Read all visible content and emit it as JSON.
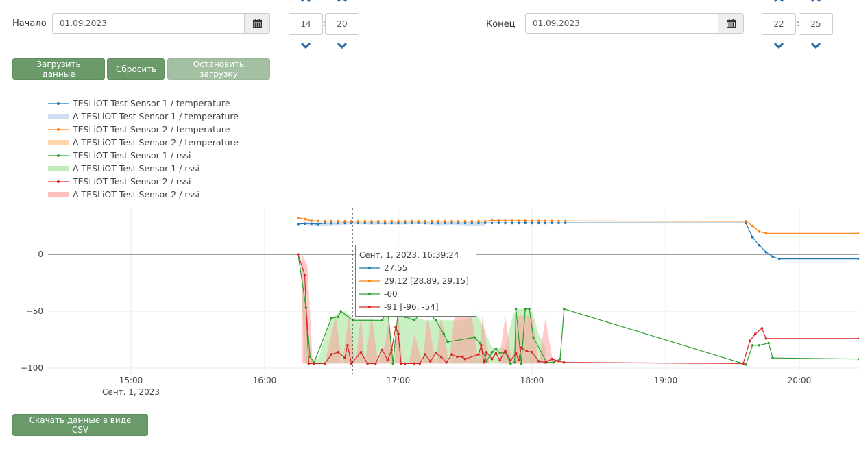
{
  "controls": {
    "start_label": "Начало",
    "start_date": "01.09.2023",
    "start_hour": "14",
    "start_minute": "20",
    "end_label": "Конец",
    "end_date": "01.09.2023",
    "end_hour": "22",
    "end_minute": "25",
    "time_separator": ":"
  },
  "buttons": {
    "load": "Загрузить данные",
    "reset": "Сбросить",
    "stop": "Остановить загрузку",
    "download_csv": "Скачать данные в виде CSV"
  },
  "legend": [
    {
      "label": "TESLiOT Test Sensor 1 / temperature",
      "kind": "line",
      "color": "#1f77b4"
    },
    {
      "label": "Δ TESLiOT Test Sensor 1 / temperature",
      "kind": "band",
      "color": "#aec7e8"
    },
    {
      "label": "TESLiOT Test Sensor 2 / temperature",
      "kind": "line",
      "color": "#ff7f0e"
    },
    {
      "label": "Δ TESLiOT Test Sensor 2 / temperature",
      "kind": "band",
      "color": "#ffbb78"
    },
    {
      "label": "TESLiOT Test Sensor 1 / rssi",
      "kind": "line",
      "color": "#2ca02c"
    },
    {
      "label": "Δ TESLiOT Test Sensor 1 / rssi",
      "kind": "band",
      "color": "#98df8a"
    },
    {
      "label": "TESLiOT Test Sensor 2 / rssi",
      "kind": "line",
      "color": "#d62728"
    },
    {
      "label": "Δ TESLiOT Test Sensor 2 / rssi",
      "kind": "band",
      "color": "#ff9896"
    }
  ],
  "tooltip": {
    "title": "Сент. 1, 2023, 16:39:24",
    "rows": [
      {
        "text": "27.55",
        "color": "#1f77b4"
      },
      {
        "text": "29.12 [28.89, 29.15]",
        "color": "#ff7f0e"
      },
      {
        "text": "-60",
        "color": "#2ca02c"
      },
      {
        "text": "-91 [-96, -54]",
        "color": "#d62728"
      }
    ]
  },
  "chart_data": {
    "type": "line",
    "x_unit": "hours",
    "xlim": [
      14.45,
      20.45
    ],
    "ylim": [
      -105,
      40
    ],
    "x_ticks": [
      {
        "value": 15,
        "label": "15:00",
        "sublabel": "Сент. 1, 2023"
      },
      {
        "value": 16,
        "label": "16:00"
      },
      {
        "value": 17,
        "label": "17:00"
      },
      {
        "value": 18,
        "label": "18:00"
      },
      {
        "value": 19,
        "label": "19:00"
      },
      {
        "value": 20,
        "label": "20:00"
      }
    ],
    "y_ticks": [
      {
        "value": 0,
        "label": "0"
      },
      {
        "value": -50,
        "label": "−50"
      },
      {
        "value": -100,
        "label": "−100"
      }
    ],
    "crosshair_x": 16.657,
    "grid": true,
    "series": [
      {
        "name": "TESLiOT Test Sensor 1 / temperature",
        "color": "#1f77b4",
        "markers": true,
        "x": [
          16.25,
          16.3,
          16.35,
          16.4,
          16.45,
          16.5,
          16.55,
          16.6,
          16.65,
          16.7,
          16.75,
          16.8,
          16.85,
          16.9,
          16.95,
          17.0,
          17.05,
          17.1,
          17.15,
          17.2,
          17.25,
          17.3,
          17.35,
          17.4,
          17.45,
          17.5,
          17.55,
          17.6,
          17.65,
          17.7,
          17.75,
          17.8,
          17.85,
          17.9,
          17.95,
          18.0,
          18.05,
          18.1,
          18.15,
          18.2,
          18.25,
          19.6,
          19.65,
          19.7,
          19.75,
          19.8,
          19.85,
          20.45
        ],
        "y": [
          26.5,
          27,
          27,
          26.5,
          27.5,
          27.3,
          27.5,
          27.5,
          27.55,
          27.5,
          27.4,
          27.5,
          27.5,
          27.3,
          27.5,
          27.4,
          27.5,
          27.5,
          27.5,
          27.5,
          27.4,
          27.5,
          27.5,
          27.5,
          27.4,
          27.5,
          27.5,
          27.5,
          27.6,
          27.5,
          27.6,
          27.5,
          27.5,
          27.5,
          27.6,
          27.5,
          27.5,
          27.5,
          27.6,
          27.5,
          27.6,
          27.5,
          15,
          8,
          2,
          -2,
          -4,
          -4
        ]
      },
      {
        "name": "TESLiOT Test Sensor 2 / temperature",
        "color": "#ff7f0e",
        "markers": true,
        "x": [
          16.25,
          16.3,
          16.35,
          16.4,
          16.45,
          16.5,
          16.55,
          16.6,
          16.65,
          16.7,
          16.75,
          16.8,
          16.85,
          16.9,
          16.95,
          17.0,
          17.05,
          17.1,
          17.15,
          17.2,
          17.25,
          17.3,
          17.35,
          17.4,
          17.45,
          17.5,
          17.55,
          17.6,
          17.65,
          17.7,
          17.75,
          17.8,
          17.85,
          17.9,
          17.95,
          18.0,
          18.05,
          18.1,
          18.15,
          18.2,
          18.25,
          19.6,
          19.65,
          19.7,
          19.75,
          20.45
        ],
        "y": [
          32,
          31,
          29.5,
          29.2,
          29.1,
          29.2,
          29.1,
          29.1,
          29.12,
          29.1,
          29.1,
          29.1,
          29.1,
          29.1,
          29.1,
          29.1,
          29.1,
          29.2,
          29.1,
          29.1,
          29.2,
          29.1,
          29.1,
          29.2,
          29.1,
          29.2,
          29.1,
          29.2,
          29.1,
          29.8,
          29.7,
          29.6,
          29.6,
          29.5,
          29.5,
          29.4,
          29.4,
          29.4,
          29.4,
          29.3,
          29.3,
          29,
          25,
          20,
          18.5,
          18.5
        ]
      },
      {
        "name": "TESLiOT Test Sensor 1 / rssi",
        "color": "#2ca02c",
        "markers": true,
        "x": [
          16.25,
          16.31,
          16.34,
          16.37,
          16.5,
          16.55,
          16.57,
          16.66,
          16.88,
          16.92,
          16.96,
          17.0,
          17.05,
          17.12,
          17.2,
          17.28,
          17.34,
          17.37,
          17.57,
          17.61,
          17.66,
          17.7,
          17.73,
          17.76,
          17.8,
          17.84,
          17.87,
          17.88,
          17.92,
          17.95,
          17.98,
          18.01,
          18.11,
          18.16,
          18.21,
          18.24,
          19.58,
          19.6,
          19.65,
          19.7,
          19.77,
          19.8,
          20.45
        ],
        "y": [
          0,
          -47,
          -90,
          -95,
          -56,
          -55,
          -50,
          -58,
          -58,
          -48,
          -96,
          -48,
          -55,
          -58,
          -48,
          -58,
          -70,
          -77,
          -73,
          -78,
          -94,
          -86,
          -83,
          -87,
          -86,
          -96,
          -95,
          -48,
          -96,
          -48,
          -48,
          -73,
          -95,
          -95,
          -92,
          -48,
          -96,
          -97,
          -80,
          -80,
          -78,
          -91,
          -92
        ]
      },
      {
        "name": "TESLiOT Test Sensor 2 / rssi",
        "color": "#d62728",
        "markers": true,
        "x": [
          16.25,
          16.3,
          16.33,
          16.37,
          16.45,
          16.5,
          16.55,
          16.6,
          16.62,
          16.65,
          16.72,
          16.77,
          16.83,
          16.88,
          16.92,
          16.95,
          16.98,
          17.0,
          17.02,
          17.05,
          17.12,
          17.16,
          17.2,
          17.24,
          17.28,
          17.32,
          17.36,
          17.4,
          17.44,
          17.48,
          17.5,
          17.6,
          17.62,
          17.64,
          17.66,
          17.7,
          17.73,
          17.76,
          17.8,
          17.84,
          17.88,
          17.9,
          17.92,
          17.96,
          18.0,
          18.05,
          18.1,
          18.15,
          18.2,
          18.24,
          19.58,
          19.63,
          19.67,
          19.72,
          19.75,
          20.45
        ],
        "y": [
          0,
          -18,
          -96,
          -96,
          -96,
          -88,
          -86,
          -91,
          -80,
          -96,
          -86,
          -96,
          -96,
          -84,
          -93,
          -84,
          -64,
          -70,
          -96,
          -96,
          -96,
          -96,
          -88,
          -94,
          -87,
          -90,
          -95,
          -88,
          -90,
          -90,
          -92,
          -88,
          -80,
          -95,
          -86,
          -92,
          -87,
          -93,
          -85,
          -93,
          -87,
          -93,
          -82,
          -85,
          -86,
          -94,
          -95,
          -92,
          -94,
          -95,
          -96,
          -76,
          -70,
          -65,
          -74,
          -74
        ]
      }
    ],
    "bands": [
      {
        "name": "Δ TESLiOT Test Sensor 1 / temperature",
        "color": "#aec7e8",
        "x": [
          16.3,
          16.4,
          16.5,
          16.6,
          16.7,
          16.8,
          16.9,
          17.0,
          17.1,
          17.2,
          17.3,
          17.4,
          17.5,
          17.6,
          17.65
        ],
        "upper": [
          28,
          28,
          28,
          28,
          28,
          28,
          28,
          28,
          28,
          28,
          28,
          28,
          28,
          28,
          28
        ],
        "lower": [
          26,
          24.5,
          25.5,
          26,
          26.5,
          26,
          26.5,
          26,
          26.5,
          26.5,
          25.5,
          26,
          25.5,
          25,
          25
        ]
      },
      {
        "name": "Δ TESLiOT Test Sensor 2 / temperature",
        "color": "#ffbb78",
        "x": [
          16.3,
          16.4,
          16.5,
          16.6,
          16.7,
          16.8,
          16.9,
          17.0,
          17.1,
          17.2,
          17.3,
          17.4,
          17.5,
          17.6,
          17.7
        ],
        "upper": [
          30,
          29.5,
          29.4,
          29.3,
          29.3,
          29.3,
          29.3,
          29.3,
          29.3,
          29.3,
          29.3,
          29.3,
          29.3,
          29.3,
          29.8
        ],
        "lower": [
          28.5,
          28.8,
          28.9,
          28.9,
          28.9,
          28.9,
          28.9,
          28.9,
          28.9,
          28.9,
          28.9,
          28.9,
          28.9,
          28.9,
          29.2
        ]
      },
      {
        "name": "Δ TESLiOT Test Sensor 1 / rssi",
        "color": "#98df8a",
        "x": [
          16.27,
          16.3,
          16.34,
          16.4,
          16.5,
          16.55,
          16.6,
          16.66,
          16.88,
          16.92,
          16.96,
          17.0,
          17.1,
          17.2,
          17.3,
          17.4,
          17.5,
          17.58,
          17.62,
          17.7,
          17.8,
          17.86,
          17.9,
          17.95,
          18.0,
          18.05,
          18.1
        ],
        "upper": [
          0,
          -40,
          -92,
          -92,
          -56,
          -52,
          -50,
          -56,
          -58,
          -48,
          -96,
          -48,
          -55,
          -58,
          -58,
          -58,
          -58,
          -52,
          -60,
          -82,
          -82,
          -52,
          -48,
          -48,
          -50,
          -70,
          -82
        ],
        "lower": [
          -10,
          -96,
          -96,
          -96,
          -96,
          -96,
          -96,
          -96,
          -96,
          -96,
          -96,
          -96,
          -96,
          -96,
          -96,
          -96,
          -96,
          -96,
          -96,
          -96,
          -96,
          -96,
          -96,
          -96,
          -96,
          -96,
          -96
        ]
      },
      {
        "name": "Δ TESLiOT Test Sensor 2 / rssi",
        "color": "#ff9896",
        "x": [
          16.28,
          16.32,
          16.36,
          16.45,
          16.5,
          16.53,
          16.58,
          16.63,
          16.68,
          16.72,
          16.75,
          16.8,
          16.85,
          16.9,
          16.93,
          16.97,
          17.0,
          17.03,
          17.08,
          17.12,
          17.18,
          17.22,
          17.28,
          17.32,
          17.38,
          17.42,
          17.5,
          17.55,
          17.6,
          17.63,
          17.68,
          17.75,
          17.8,
          17.85,
          17.9,
          17.95,
          18.0,
          18.05,
          18.1,
          18.15,
          18.2
        ],
        "upper": [
          0,
          -10,
          -96,
          -96,
          -70,
          -54,
          -96,
          -54,
          -96,
          -54,
          -96,
          -54,
          -96,
          -80,
          -54,
          -96,
          -54,
          -96,
          -96,
          -70,
          -96,
          -54,
          -96,
          -54,
          -96,
          -54,
          -54,
          -54,
          -96,
          -54,
          -96,
          -96,
          -54,
          -96,
          -54,
          -54,
          -54,
          -96,
          -56,
          -90,
          -96
        ],
        "lower": [
          -96,
          -96,
          -96,
          -96,
          -96,
          -96,
          -96,
          -96,
          -96,
          -96,
          -96,
          -96,
          -96,
          -96,
          -96,
          -96,
          -96,
          -96,
          -96,
          -96,
          -96,
          -96,
          -96,
          -96,
          -96,
          -96,
          -96,
          -96,
          -96,
          -96,
          -96,
          -96,
          -96,
          -96,
          -96,
          -96,
          -96,
          -96,
          -96,
          -96,
          -96
        ]
      }
    ]
  }
}
